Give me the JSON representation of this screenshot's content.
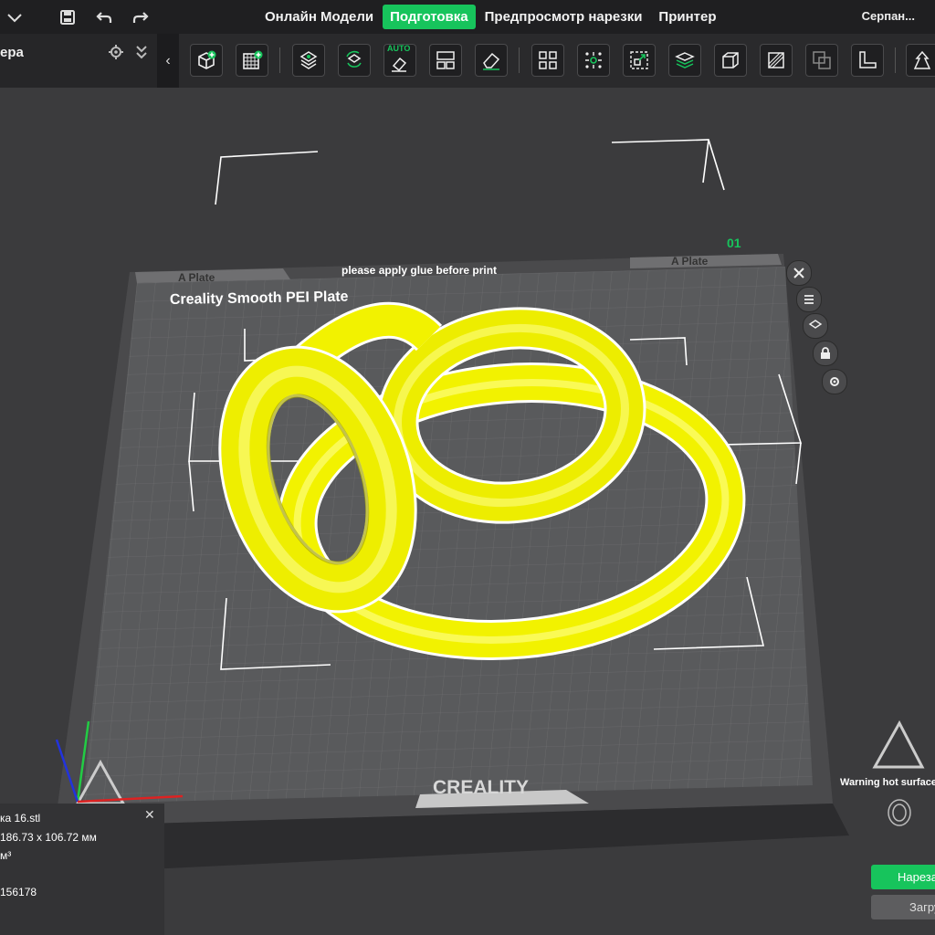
{
  "titlebar": {
    "tabs": [
      {
        "label": "Онлайн Модели",
        "active": false
      },
      {
        "label": "Подготовка",
        "active": true
      },
      {
        "label": "Предпросмотр нарезки",
        "active": false
      },
      {
        "label": "Принтер",
        "active": false
      }
    ],
    "project_name": "Серпан..."
  },
  "left_panel": {
    "title": "ера"
  },
  "toolbar": {
    "auto_badge": "AUTO",
    "tools": [
      "add-object-icon",
      "add-plate-icon",
      "auto-arrange-icon",
      "orient-icon",
      "auto-orient-icon",
      "split-plate-icon",
      "eraser-icon",
      "layout-icon",
      "scale-icon",
      "cut-icon",
      "layers-icon",
      "box-icon",
      "slash-icon",
      "boolean-icon",
      "measure-icon",
      "support-icon"
    ]
  },
  "plate": {
    "label_left": "A Plate",
    "label_right": "A Plate",
    "notice": "please apply glue before print",
    "plate_name": "Creality Smooth PEI Plate",
    "plate_number": "01",
    "brand": "CREALITY",
    "warning_left": "Warning hot surface",
    "warning_right": "Warning hot surface"
  },
  "model": {
    "color": "#f2f200"
  },
  "object_info": {
    "name": "ка 16.stl",
    "size": "186.73 x 106.72 мм",
    "volume": "м³",
    "facets": "156178"
  },
  "actions": {
    "slice_label": "Нарезать",
    "upload_label": "Загрузить"
  },
  "colors": {
    "accent": "#17c45c",
    "titlebar": "#1f1f21",
    "viewport": "#3b3b3d"
  }
}
